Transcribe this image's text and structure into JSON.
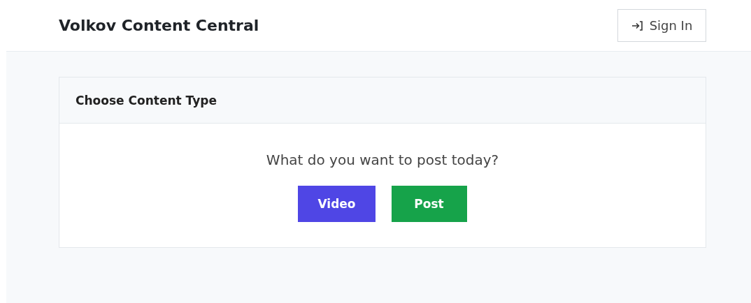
{
  "header": {
    "title": "Volkov Content Central",
    "sign_in": "Sign In"
  },
  "card": {
    "title": "Choose Content Type",
    "question": "What do you want to post today?",
    "buttons": [
      {
        "label": "Video",
        "color": "#4f46e5"
      },
      {
        "label": "Post",
        "color": "#16a34a"
      }
    ]
  }
}
